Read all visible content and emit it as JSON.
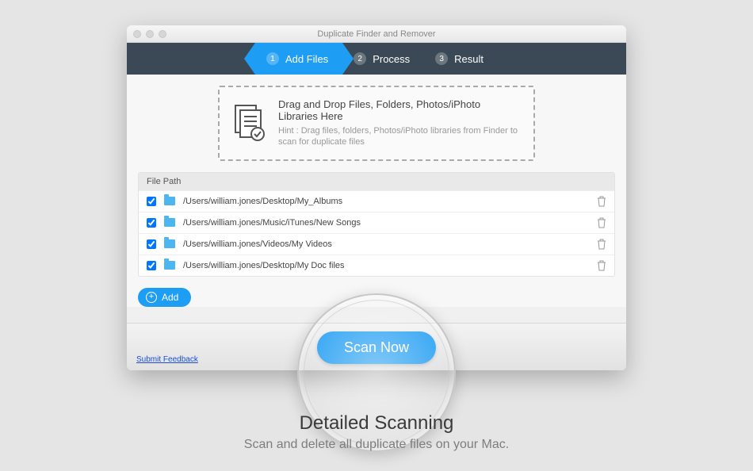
{
  "window": {
    "title": "Duplicate Finder and Remover"
  },
  "steps": [
    {
      "num": "1",
      "label": "Add Files"
    },
    {
      "num": "2",
      "label": "Process"
    },
    {
      "num": "3",
      "label": "Result"
    }
  ],
  "dropzone": {
    "title": "Drag and Drop Files, Folders, Photos/iPhoto Libraries Here",
    "hint": "Hint : Drag files, folders, Photos/iPhoto libraries from Finder to scan for duplicate files"
  },
  "list": {
    "header": "File Path",
    "rows": [
      {
        "path": "/Users/william.jones/Desktop/My_Albums"
      },
      {
        "path": "/Users/william.jones/Music/iTunes/New Songs"
      },
      {
        "path": "/Users/william.jones/Videos/My Videos"
      },
      {
        "path": "/Users/william.jones/Desktop/My Doc files"
      }
    ]
  },
  "buttons": {
    "add": "Add",
    "scan": "Scan Now",
    "feedback": "Submit Feedback"
  },
  "caption": {
    "title": "Detailed Scanning",
    "sub": "Scan and delete all duplicate files on your Mac."
  }
}
